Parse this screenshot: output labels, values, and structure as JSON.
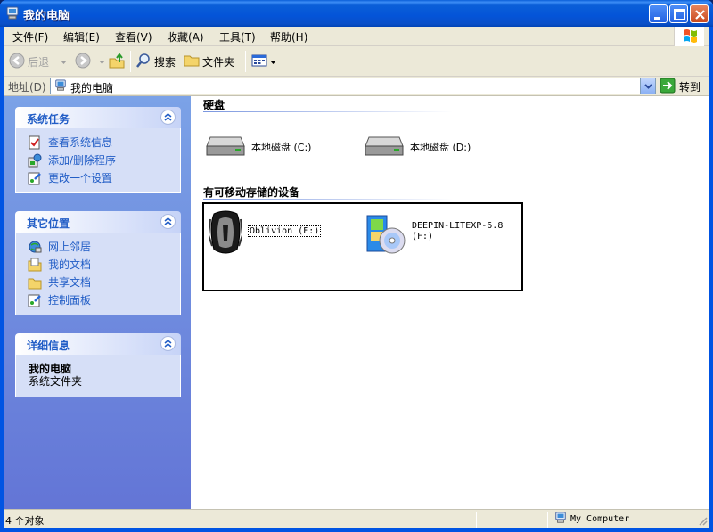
{
  "window": {
    "title": "我的电脑"
  },
  "menubar": {
    "items": [
      "文件(F)",
      "编辑(E)",
      "查看(V)",
      "收藏(A)",
      "工具(T)",
      "帮助(H)"
    ]
  },
  "toolbar": {
    "back_label": "后退",
    "search_label": "搜索",
    "folders_label": "文件夹"
  },
  "addressbar": {
    "label": "地址(D)",
    "value": "我的电脑",
    "go_label": "转到"
  },
  "leftpane": {
    "system_tasks": {
      "title": "系统任务",
      "links": [
        "查看系统信息",
        "添加/删除程序",
        "更改一个设置"
      ]
    },
    "other_places": {
      "title": "其它位置",
      "links": [
        "网上邻居",
        "我的文档",
        "共享文档",
        "控制面板"
      ]
    },
    "details": {
      "title": "详细信息",
      "name": "我的电脑",
      "type": "系统文件夹"
    }
  },
  "main": {
    "hard_disks": {
      "title": "硬盘",
      "drives": [
        {
          "label": "本地磁盘 (C:)"
        },
        {
          "label": "本地磁盘 (D:)"
        }
      ]
    },
    "removable": {
      "title": "有可移动存储的设备",
      "drives": [
        {
          "label": "Oblivion (E:)"
        },
        {
          "label_line1": "DEEPIN-LITEXP-6.8",
          "label_line2": "(F:)"
        }
      ]
    }
  },
  "statusbar": {
    "object_count": "4 个对象",
    "location": "My Computer"
  },
  "colors": {
    "titlebar": "#0054e3",
    "taskpane_link": "#215dc6",
    "taskpane_bg": "#6375d6"
  }
}
